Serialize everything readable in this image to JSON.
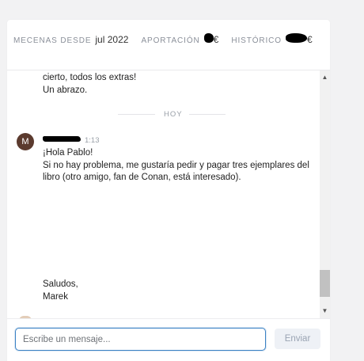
{
  "stats": {
    "patron_since_label": "Mecenas desde",
    "patron_since_value": "jul 2022",
    "contribution_label": "Aportación",
    "contribution_currency": "€",
    "history_label": "Histórico",
    "history_currency": "€"
  },
  "thread": {
    "previous_message": {
      "line1": "cierto, todos los extras!",
      "line2": "Un abrazo."
    },
    "day_separator": "HOY",
    "message": {
      "avatar_initial": "M",
      "time": "1:13",
      "line1": "¡Hola Pablo!",
      "line2": "Si no hay problema, me gustaría pedir y pagar tres ejemplares del",
      "line3": "libro (otro amigo, fan de Conan, está interesado).",
      "closing1": "Saludos,",
      "closing2": "Marek"
    }
  },
  "composer": {
    "placeholder": "Escribe un mensaje...",
    "value": "",
    "send_label": "Enviar"
  },
  "scrollbar": {
    "up_glyph": "▲",
    "down_glyph": "▼"
  },
  "colors": {
    "avatar_bg": "#5b3a2e",
    "input_border": "#3b82c4",
    "send_bg": "#eef1f6"
  }
}
